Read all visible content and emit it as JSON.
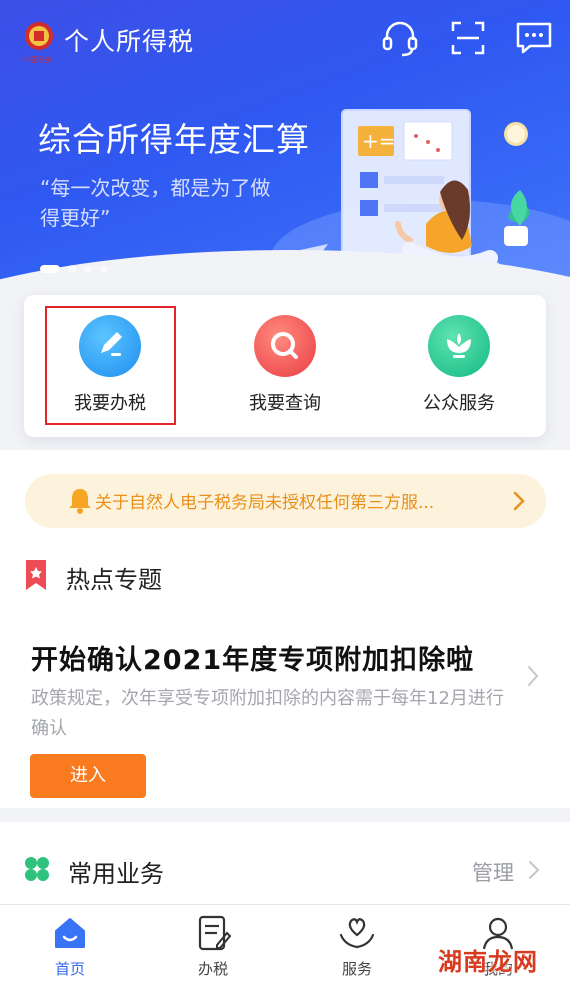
{
  "header": {
    "app_title": "个人所得税",
    "logo_text": "中国税务"
  },
  "banner": {
    "title": "综合所得年度汇算",
    "subtitle": "“每一次改变，都是为了做得更好”",
    "slide_count": 4,
    "active_slide": 1
  },
  "quick_actions": [
    {
      "label": "我要办税",
      "icon": "pencil-icon",
      "color": "#2b9ef0"
    },
    {
      "label": "我要查询",
      "icon": "search-icon",
      "color": "#f2544f"
    },
    {
      "label": "公众服务",
      "icon": "flower-icon",
      "color": "#23c48e"
    }
  ],
  "notice": {
    "text": "关于自然人电子税务局未授权任何第三方服..."
  },
  "hot_topics": {
    "section_title": "热点专题",
    "topic_title": "开始确认2021年度专项附加扣除啦",
    "topic_desc": "政策规定，次年享受专项附加扣除的内容需于每年12月进行确认",
    "enter_label": "进入"
  },
  "common": {
    "section_title": "常用业务",
    "manage_label": "管理"
  },
  "bottom_nav": [
    {
      "label": "首页",
      "icon": "home-icon",
      "active": true
    },
    {
      "label": "办税",
      "icon": "form-icon",
      "active": false
    },
    {
      "label": "服务",
      "icon": "heart-hands-icon",
      "active": false
    },
    {
      "label": "我的",
      "icon": "user-icon",
      "active": false
    }
  ],
  "watermark": "湖南龙网",
  "colors": {
    "brand_blue": "#3267f0",
    "accent_orange": "#f97a1f",
    "highlight_red": "#e0242c"
  }
}
